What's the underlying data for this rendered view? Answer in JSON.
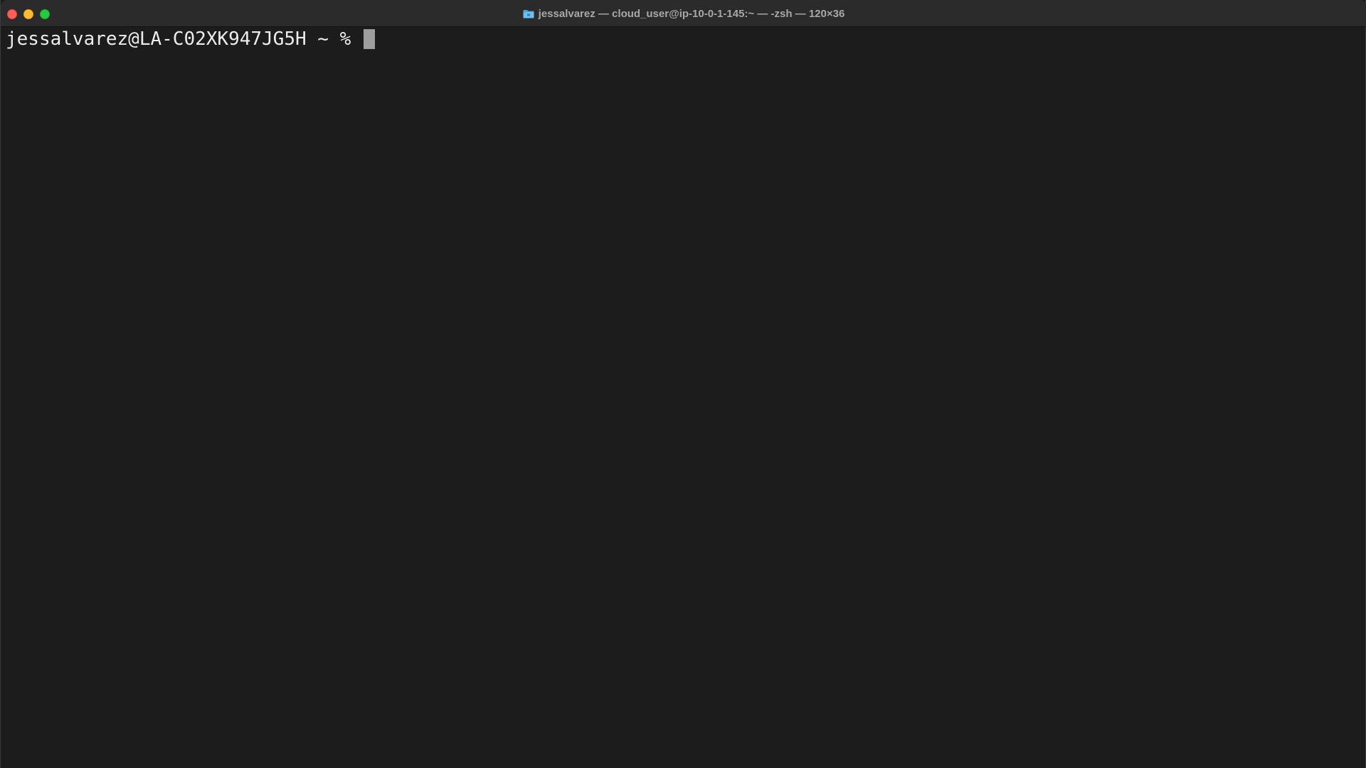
{
  "window": {
    "title": "jessalvarez — cloud_user@ip-10-0-1-145:~ — -zsh — 120×36",
    "title_icon": "folder-icon",
    "traffic_lights": {
      "close_color": "#fe5f57",
      "minimize_color": "#febc2e",
      "zoom_color": "#28c840"
    }
  },
  "terminal": {
    "background": "#1c1c1c",
    "foreground": "#ececec",
    "prompt": "jessalvarez@LA-C02XK947JG5H ~ % ",
    "input": ""
  }
}
